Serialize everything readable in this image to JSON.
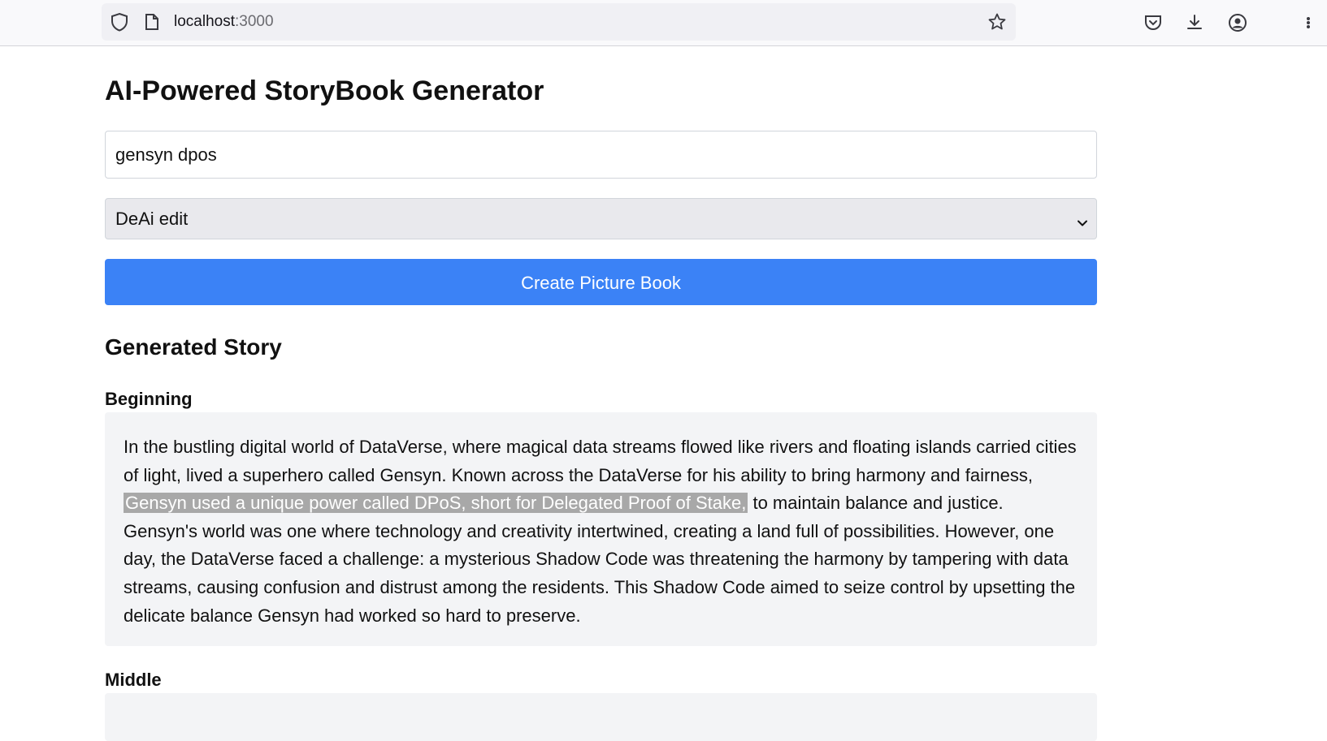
{
  "browser": {
    "url_host": "localhost",
    "url_port": ":3000",
    "icons": [
      "shield-icon",
      "page-icon",
      "star-icon",
      "pocket-icon",
      "download-icon",
      "account-icon"
    ]
  },
  "page": {
    "title": "AI-Powered StoryBook Generator",
    "prompt_value": "gensyn dpos",
    "style_selected": "DeAi edit",
    "create_button_label": "Create Picture Book",
    "generated_title": "Generated Story"
  },
  "story": {
    "beginning": {
      "heading": "Beginning",
      "text_before": "In the bustling digital world of DataVerse, where magical data streams flowed like rivers and floating islands carried cities of light, lived a superhero called Gensyn. Known across the DataVerse for his ability to bring harmony and fairness,",
      "text_highlight": "Gensyn used a unique power called DPoS, short for Delegated Proof of Stake,",
      "text_after": "to maintain balance and justice. Gensyn's world was one where technology and creativity intertwined, creating a land full of possibilities. However, one day, the DataVerse faced a challenge: a mysterious Shadow Code was threatening the harmony by tampering with data streams, causing confusion and distrust among the residents. This Shadow Code aimed to seize control by upsetting the delicate balance Gensyn had worked so hard to preserve."
    },
    "middle": {
      "heading": "Middle"
    }
  },
  "colors": {
    "accent": "#3b82f6",
    "highlight": "#a8a8a8",
    "box_bg": "#f3f4f6"
  }
}
